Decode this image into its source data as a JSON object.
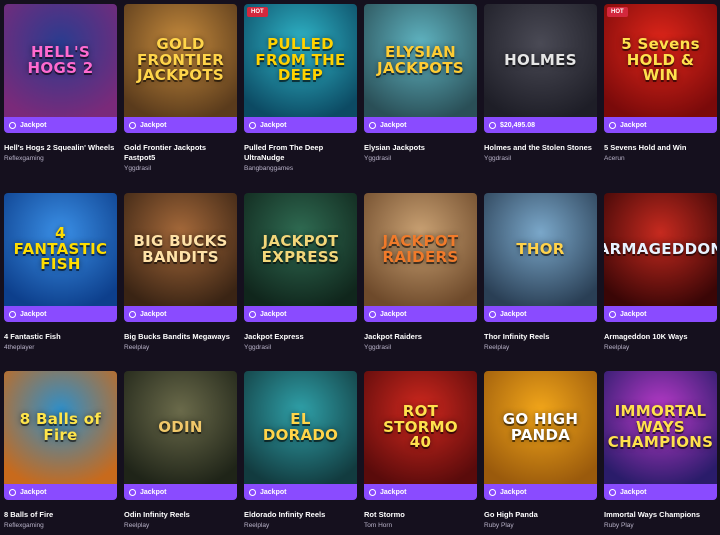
{
  "games": [
    {
      "title": "Hell's Hogs 2 Squealin' Wheels",
      "provider": "Reflexgaming",
      "badge": "Jackpot",
      "thumb_text": "HELL'S HOGS 2",
      "hot": "",
      "bg1": "#2a3c8f",
      "bg2": "#7a2a7a",
      "fg": "#ff6ad0"
    },
    {
      "title": "Gold Frontier Jackpots Fastpot5",
      "provider": "Yggdrasil",
      "badge": "Jackpot",
      "thumb_text": "GOLD FRONTIER JACKPOTS",
      "hot": "",
      "bg1": "#c58a3c",
      "bg2": "#5a3b1c",
      "fg": "#ffd54a"
    },
    {
      "title": "Pulled From The Deep UltraNudge",
      "provider": "Bangbanggames",
      "badge": "Jackpot",
      "thumb_text": "PULLED FROM THE DEEP",
      "hot": "HOT",
      "bg1": "#2fb5c8",
      "bg2": "#0c4a63",
      "fg": "#ffd200"
    },
    {
      "title": "Elysian Jackpots",
      "provider": "Yggdrasil",
      "badge": "Jackpot",
      "thumb_text": "ELYSIAN JACKPOTS",
      "hot": "",
      "bg1": "#5fb3c0",
      "bg2": "#2a4f57",
      "fg": "#ffcc33"
    },
    {
      "title": "Holmes and the Stolen Stones",
      "provider": "Yggdrasil",
      "badge": "$20,495.08",
      "thumb_text": "HOLMES",
      "hot": "",
      "bg1": "#4a4a55",
      "bg2": "#1e1e27",
      "fg": "#e6e6e6"
    },
    {
      "title": "5 Sevens Hold and Win",
      "provider": "Acerun",
      "badge": "Jackpot",
      "thumb_text": "5 Sevens HOLD & WIN",
      "hot": "HOT",
      "bg1": "#e0261a",
      "bg2": "#7a0a0a",
      "fg": "#ffe14d"
    },
    {
      "title": "4 Fantastic Fish",
      "provider": "4theplayer",
      "badge": "Jackpot",
      "thumb_text": "4 FANTASTIC FISH",
      "hot": "",
      "bg1": "#3a8fe6",
      "bg2": "#0d3f8c",
      "fg": "#ffdd00"
    },
    {
      "title": "Big Bucks Bandits Megaways",
      "provider": "Reelplay",
      "badge": "Jackpot",
      "thumb_text": "BIG BUCKS BANDITS",
      "hot": "",
      "bg1": "#a5693a",
      "bg2": "#3a2414",
      "fg": "#ffe2a8"
    },
    {
      "title": "Jackpot Express",
      "provider": "Yggdrasil",
      "badge": "Jackpot",
      "thumb_text": "JACKPOT EXPRESS",
      "hot": "",
      "bg1": "#2f6b52",
      "bg2": "#10261c",
      "fg": "#f3d77a"
    },
    {
      "title": "Jackpot Raiders",
      "provider": "Yggdrasil",
      "badge": "Jackpot",
      "thumb_text": "JACKPOT RAIDERS",
      "hot": "",
      "bg1": "#c9a173",
      "bg2": "#6e4a2b",
      "fg": "#f07a2a"
    },
    {
      "title": "Thor Infinity Reels",
      "provider": "Reelplay",
      "badge": "Jackpot",
      "thumb_text": "THOR",
      "hot": "",
      "bg1": "#7aa7c9",
      "bg2": "#2a3f55",
      "fg": "#ffd24a"
    },
    {
      "title": "Armageddon 10K Ways",
      "provider": "Reelplay",
      "badge": "Jackpot",
      "thumb_text": "ARMAGEDDON",
      "hot": "",
      "bg1": "#c62a1f",
      "bg2": "#3a0606",
      "fg": "#e8f2ff"
    },
    {
      "title": "8 Balls of Fire",
      "provider": "Reflexgaming",
      "badge": "Jackpot",
      "thumb_text": "8 Balls of Fire",
      "hot": "",
      "bg1": "#2f8fc9",
      "bg2": "#c86a1c",
      "fg": "#ffe54a"
    },
    {
      "title": "Odin Infinity Reels",
      "provider": "Reelplay",
      "badge": "Jackpot",
      "thumb_text": "ODIN",
      "hot": "",
      "bg1": "#6a6a4a",
      "bg2": "#1f2418",
      "fg": "#f0c86a"
    },
    {
      "title": "Eldorado Infinity Reels",
      "provider": "Reelplay",
      "badge": "Jackpot",
      "thumb_text": "EL DORADO",
      "hot": "",
      "bg1": "#2fa0a8",
      "bg2": "#123b3f",
      "fg": "#ffd54a"
    },
    {
      "title": "Rot Stormo",
      "provider": "Tom Horn",
      "badge": "Jackpot",
      "thumb_text": "ROT STORMO 40",
      "hot": "",
      "bg1": "#d0281e",
      "bg2": "#5a0b0b",
      "fg": "#ffe14d"
    },
    {
      "title": "Go High Panda",
      "provider": "Ruby Play",
      "badge": "Jackpot",
      "thumb_text": "GO HIGH PANDA",
      "hot": "",
      "bg1": "#f2a61a",
      "bg2": "#9a5a0c",
      "fg": "#ffffff"
    },
    {
      "title": "Immortal Ways Champions",
      "provider": "Ruby Play",
      "badge": "Jackpot",
      "thumb_text": "IMMORTAL WAYS CHAMPIONS",
      "hot": "",
      "bg1": "#b93ac9",
      "bg2": "#2a1c6a",
      "fg": "#ffe14d"
    }
  ]
}
